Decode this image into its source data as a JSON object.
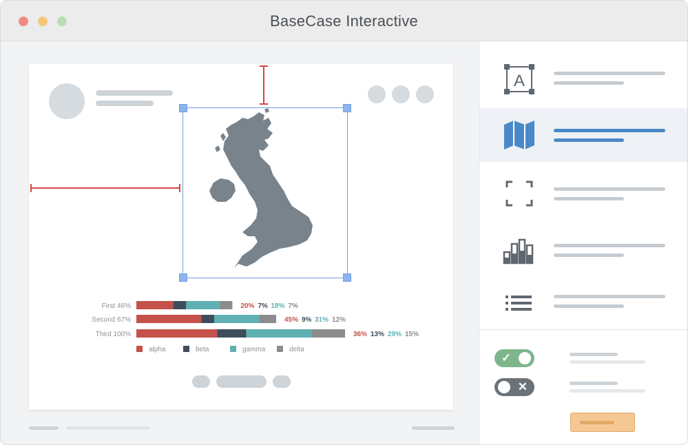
{
  "window": {
    "title": "BaseCase Interactive"
  },
  "chart_data": {
    "type": "bar",
    "stacked": true,
    "orientation": "horizontal",
    "categories": [
      {
        "label": "First",
        "total": "46%"
      },
      {
        "label": "Second",
        "total": "67%"
      },
      {
        "label": "Third",
        "total": "100%"
      }
    ],
    "category_totals": [
      46,
      67,
      100
    ],
    "series": [
      {
        "name": "alpha",
        "color": "#c4514a",
        "values": [
          20,
          45,
          36
        ],
        "labels": [
          "20%",
          "45%",
          "36%"
        ]
      },
      {
        "name": "beta",
        "color": "#3e4d5c",
        "values": [
          7,
          9,
          13
        ],
        "labels": [
          "7%",
          "9%",
          "13%"
        ]
      },
      {
        "name": "gamma",
        "color": "#5fb0b3",
        "values": [
          18,
          31,
          29
        ],
        "labels": [
          "18%",
          "31%",
          "29%"
        ]
      },
      {
        "name": "delta",
        "color": "#8c8c8c",
        "values": [
          7,
          12,
          15
        ],
        "labels": [
          "7%",
          "12%",
          "15%"
        ]
      }
    ],
    "legend_position": "bottom"
  },
  "tools": [
    {
      "icon": "text-box-icon",
      "active": false
    },
    {
      "icon": "map-icon",
      "active": true
    },
    {
      "icon": "fullscreen-frame-icon",
      "active": false
    },
    {
      "icon": "bar-chart-icon",
      "active": false
    },
    {
      "icon": "list-icon",
      "active": false
    }
  ],
  "toggles": [
    {
      "state": "on",
      "glyph": "✓"
    },
    {
      "state": "off",
      "glyph": "✕"
    }
  ],
  "colors": {
    "selection": "#6f9fe0",
    "measure": "#d64541",
    "map": "#78838c",
    "active_tool": "#4a89c8",
    "toggle_on": "#7cb68a",
    "toggle_off": "#6b7378",
    "cta": "#f5c793"
  }
}
